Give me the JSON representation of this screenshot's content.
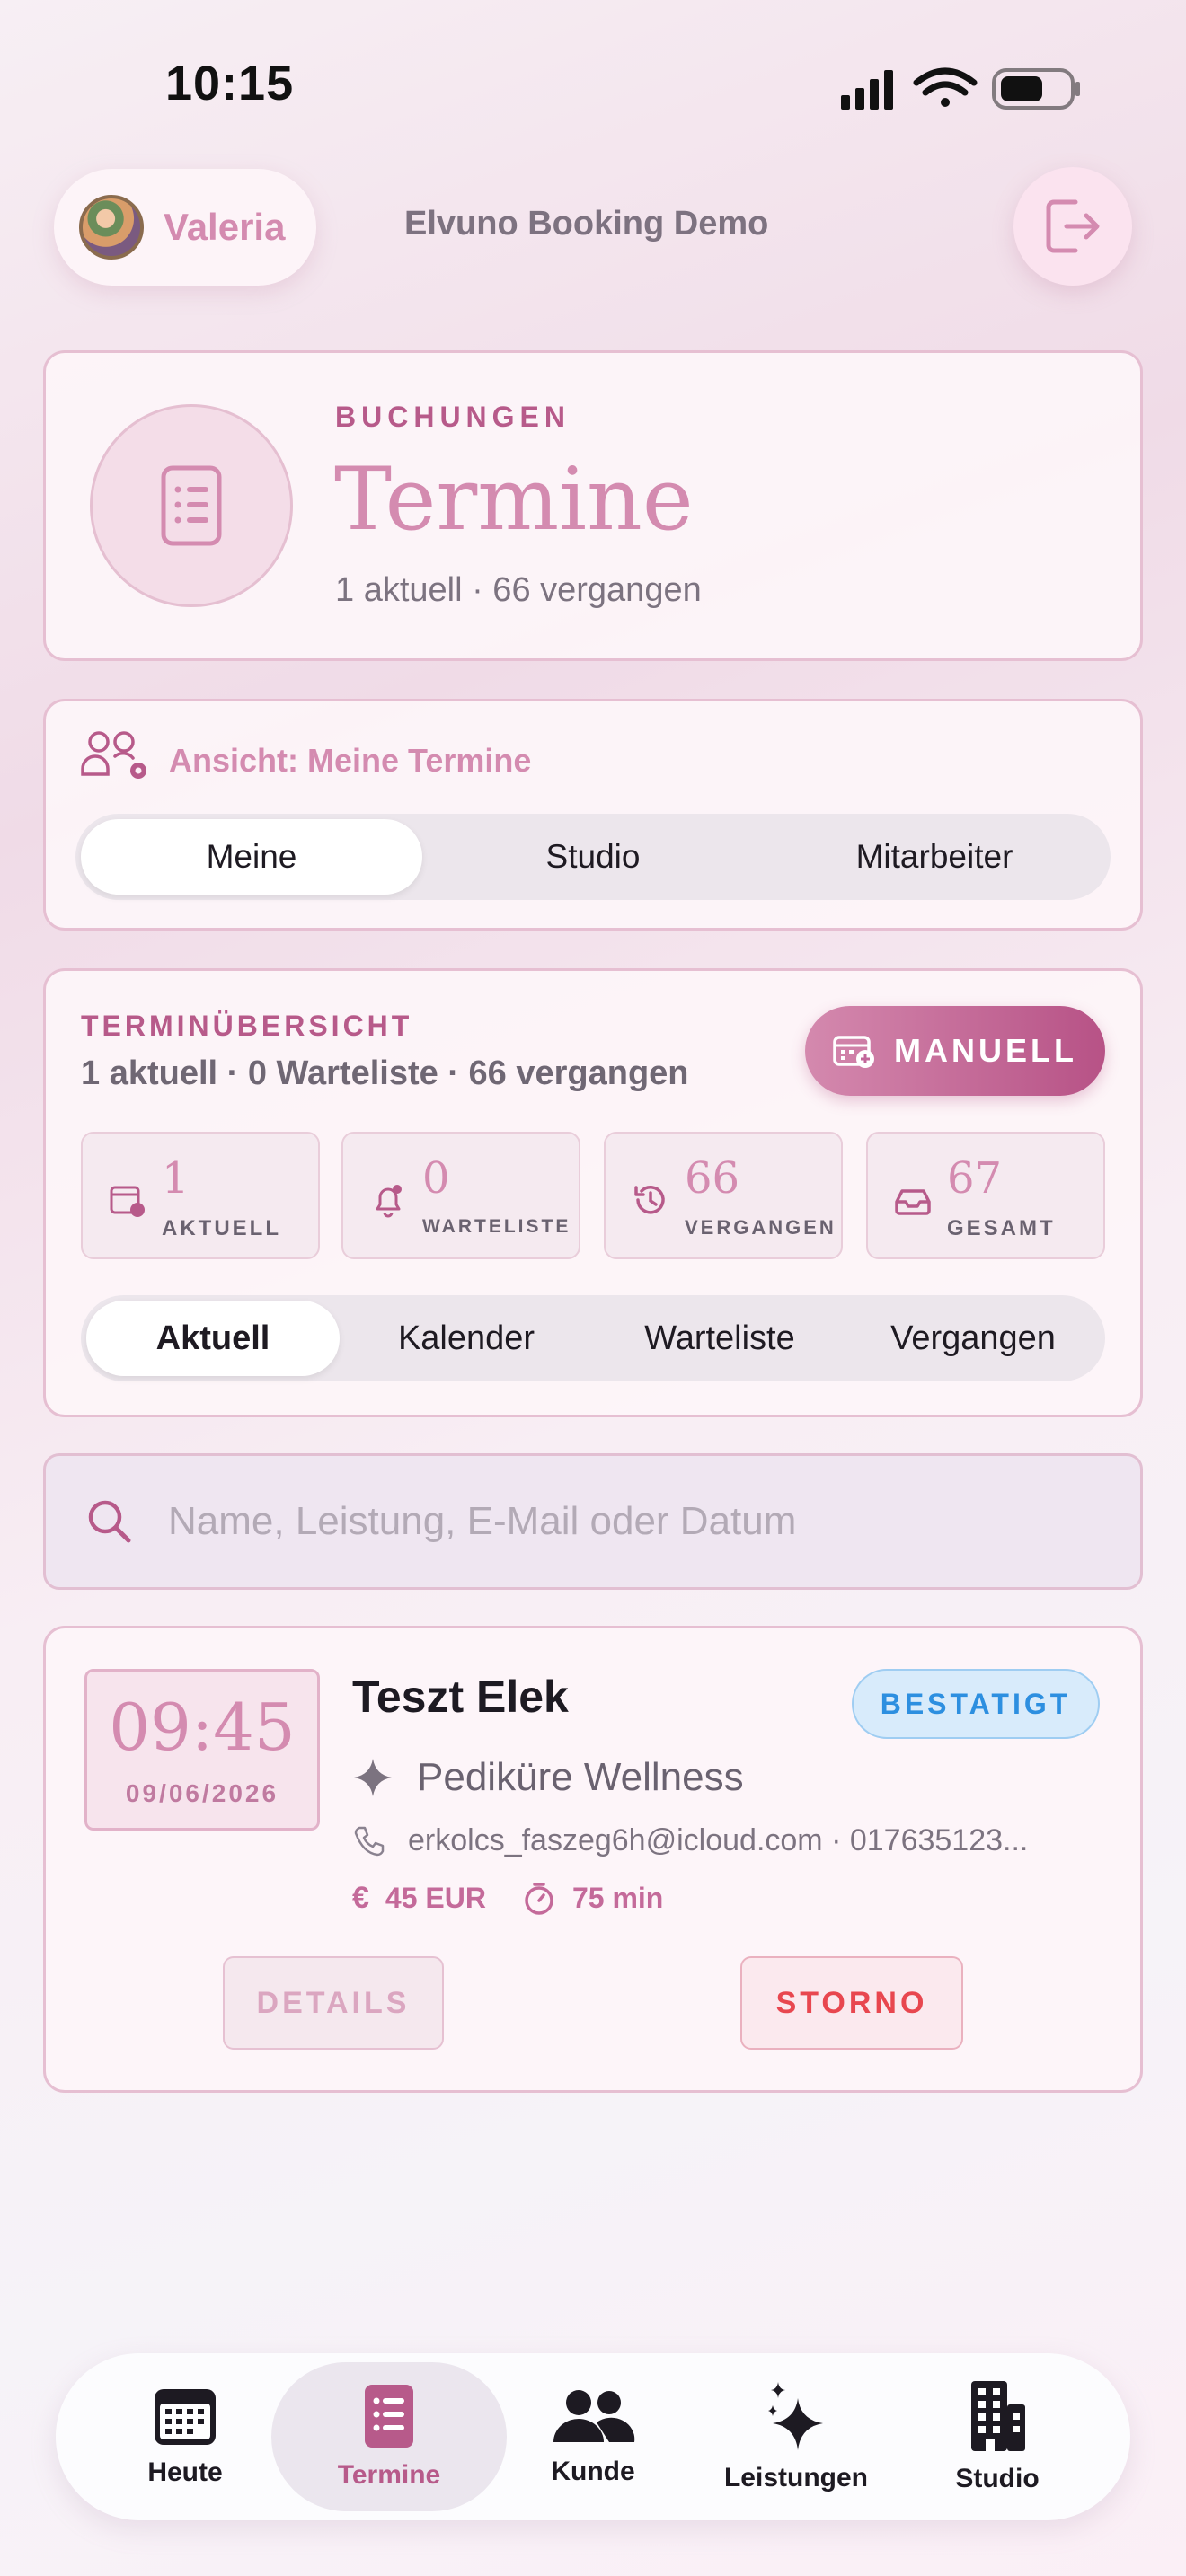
{
  "status_bar": {
    "time": "10:15"
  },
  "header": {
    "user_name": "Valeria",
    "app_title": "Elvuno Booking Demo",
    "logout_icon": "logout-icon"
  },
  "hero": {
    "overline": "BUCHUNGEN",
    "title": "Termine",
    "subtitle": "1 aktuell · 66 vergangen"
  },
  "view_selector": {
    "label": "Ansicht: Meine Termine",
    "options": [
      "Meine",
      "Studio",
      "Mitarbeiter"
    ],
    "selected": "Meine"
  },
  "overview": {
    "overline": "TERMINÜBERSICHT",
    "subtitle": "1 aktuell · 0 Warteliste · 66 vergangen",
    "manual_button": "MANUELL",
    "stats": [
      {
        "value": "1",
        "label": "AKTUELL",
        "icon": "calendar-clock-icon"
      },
      {
        "value": "0",
        "label": "WARTELISTE",
        "icon": "bell-icon"
      },
      {
        "value": "66",
        "label": "VERGANGEN",
        "icon": "history-icon"
      },
      {
        "value": "67",
        "label": "GESAMT",
        "icon": "inbox-icon"
      }
    ],
    "tabs": [
      "Aktuell",
      "Kalender",
      "Warteliste",
      "Vergangen"
    ],
    "selected_tab": "Aktuell"
  },
  "search": {
    "placeholder": "Name, Leistung, E-Mail oder Datum"
  },
  "appointment": {
    "time": "09:45",
    "date": "09/06/2026",
    "customer": "Teszt Elek",
    "status": "BESTATIGT",
    "service": "Pediküre Wellness",
    "contact": "erkolcs_faszeg6h@icloud.com · 017635123...",
    "price": "45 EUR",
    "duration": "75 min",
    "details_button": "DETAILS",
    "cancel_button": "STORNO"
  },
  "tabbar": {
    "items": [
      {
        "label": "Heute",
        "icon": "calendar-icon"
      },
      {
        "label": "Termine",
        "icon": "list-icon"
      },
      {
        "label": "Kunde",
        "icon": "people-icon"
      },
      {
        "label": "Leistungen",
        "icon": "sparkles-icon"
      },
      {
        "label": "Studio",
        "icon": "building-icon"
      }
    ],
    "active": "Termine"
  },
  "colors": {
    "accent": "#b75a8a",
    "accent_light": "#d48bb0",
    "badge_blue": "#2d8fe0",
    "danger": "#e8474f"
  }
}
